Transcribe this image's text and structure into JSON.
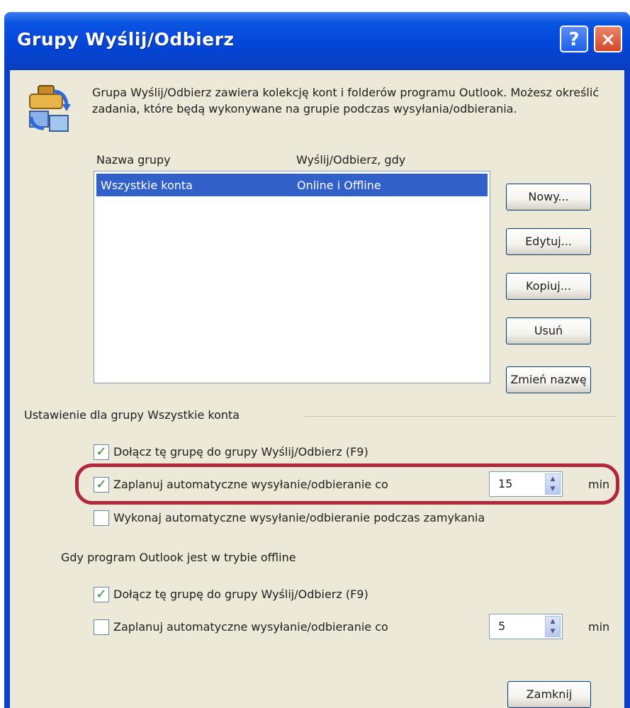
{
  "window": {
    "title": "Grupy Wyślij/Odbierz",
    "help_label": "?",
    "close_label": "×"
  },
  "description": "Grupa Wyślij/Odbierz zawiera kolekcję kont i folderów programu Outlook. Możesz określić zadania, które będą wykonywane na grupie podczas wysyłania/odbierania.",
  "list": {
    "headers": [
      "Nazwa grupy",
      "Wyślij/Odbierz, gdy"
    ],
    "rows": [
      {
        "name": "Wszystkie konta",
        "when": "Online i Offline",
        "selected": true
      }
    ]
  },
  "buttons": {
    "new": "Nowy...",
    "edit": "Edytuj...",
    "copy": "Kopiuj...",
    "delete": "Usuń",
    "rename": "Zmień nazwę",
    "close": "Zamknij"
  },
  "online_section": {
    "legend": "Ustawienie dla grupy Wszystkie konta",
    "include": {
      "label": "Dołącz tę grupę do grupy Wyślij/Odbierz (F9)",
      "checked": true
    },
    "schedule": {
      "label": "Zaplanuj automatyczne wysyłanie/odbieranie co",
      "checked": true,
      "value": "15",
      "unit": "min"
    },
    "on_exit": {
      "label": "Wykonaj automatyczne wysyłanie/odbieranie podczas zamykania",
      "checked": false
    }
  },
  "offline_section": {
    "legend": "Gdy program Outlook jest w trybie offline",
    "include": {
      "label": "Dołącz tę grupę do grupy Wyślij/Odbierz (F9)",
      "checked": true
    },
    "schedule": {
      "label": "Zaplanuj automatyczne wysyłanie/odbieranie co",
      "checked": false,
      "value": "5",
      "unit": "min"
    }
  },
  "colors": {
    "titlebar": "#0346d8",
    "selection": "#3160c8",
    "highlight_ring": "#b1273c",
    "face": "#ece9d8"
  },
  "icons": {
    "dialog": "send-receive-groups-icon",
    "check": "checkmark-icon"
  }
}
